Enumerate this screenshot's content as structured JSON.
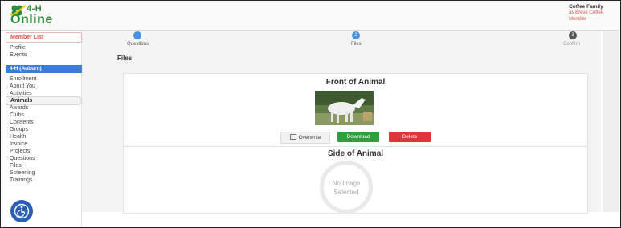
{
  "app": {
    "logo_brand": "4-H",
    "logo_product": "Online"
  },
  "user": {
    "name": "Coffee Family",
    "line2": "as Breve Coffee",
    "role": "Member"
  },
  "sidebar": {
    "member_list": "Member List",
    "top_links": [
      "Profile",
      "Events"
    ],
    "group_label": "4-H (Auburn)",
    "items": [
      "Enrollment",
      "About You",
      "Activities",
      "Animals",
      "Awards",
      "Clubs",
      "Consents",
      "Groups",
      "Health",
      "Invoice",
      "Projects",
      "Questions",
      "Files",
      "Screening",
      "Trainings"
    ],
    "active_item": "Animals"
  },
  "steps": [
    {
      "number": "",
      "label": "Questions",
      "state": "done"
    },
    {
      "number": "2",
      "label": "Files",
      "state": "current"
    },
    {
      "number": "3",
      "label": "Confirm",
      "state": "pending"
    }
  ],
  "files": {
    "section_title": "Files",
    "front": {
      "title": "Front of Animal",
      "overwrite_label": "Overwrite",
      "download_label": "Download",
      "delete_label": "Delete"
    },
    "side": {
      "title": "Side of Animal",
      "placeholder": "No Image Selected"
    }
  },
  "colors": {
    "brand_green": "#2e8b3d",
    "accent_blue": "#3c7bd6",
    "danger_red": "#e0343d",
    "success_green": "#2e9e3e",
    "member_red": "#d9534f"
  },
  "icons": {
    "accessibility": "accessibility-icon",
    "overwrite": "image-icon"
  }
}
